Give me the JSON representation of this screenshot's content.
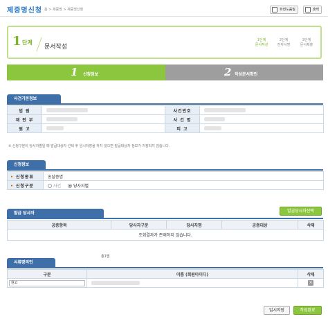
{
  "header": {
    "title": "제증명신청",
    "breadcrumb": "홈 > 제증명 > 제증명신청",
    "guide_button": "화면도움말",
    "print_button": "출력"
  },
  "step": {
    "number": "1",
    "label": "단계",
    "title": "문서작성",
    "mini_steps": [
      {
        "line1": "1단계",
        "line2": "문서작성"
      },
      {
        "line1": "2단계",
        "line2": "전자서명"
      },
      {
        "line1": "3단계",
        "line2": "문서제출"
      }
    ]
  },
  "progress": [
    {
      "num": "1",
      "label": "신청정보"
    },
    {
      "num": "2",
      "label": "작성문서확인"
    }
  ],
  "case_info": {
    "section_title": "사건기본정보",
    "rows": [
      {
        "l1": "법 원",
        "l2": "사건번호"
      },
      {
        "l1": "재 판 부",
        "l2": "사 건 명"
      },
      {
        "l1": "원 고",
        "l2": "피 고"
      }
    ],
    "notice": "※ 신청구분이 당사자별일 때 발급대상자 선택 후 임시저장을 하지 않으면 발급대상자 정보가 저장되지 않습니다."
  },
  "apply_info": {
    "section_title": "신청정보",
    "type_label": "신청종류",
    "type_value": "송달증명",
    "kind_label": "신청구분",
    "kind_options": [
      "사건",
      "당사자별"
    ]
  },
  "issue_party": {
    "section_title": "발급 당사자",
    "select_button": "발급당사자선택",
    "columns": [
      "공증항목",
      "당사자구분",
      "당사자명",
      "공증대상",
      "삭제"
    ],
    "empty_message": "조회결과가 존재하지 않습니다."
  },
  "doc_owner": {
    "section_title": "서류명의인",
    "count": "총1명",
    "columns": [
      "구분",
      "이름 (회원아이디)",
      "삭제"
    ],
    "row_value": "원고"
  },
  "footer": {
    "temp_save": "임시저장",
    "complete": "작성완료"
  },
  "colors": {
    "accent_green": "#8cc63f",
    "section_blue": "#3f6fa8",
    "title_blue": "#2a79c4"
  }
}
